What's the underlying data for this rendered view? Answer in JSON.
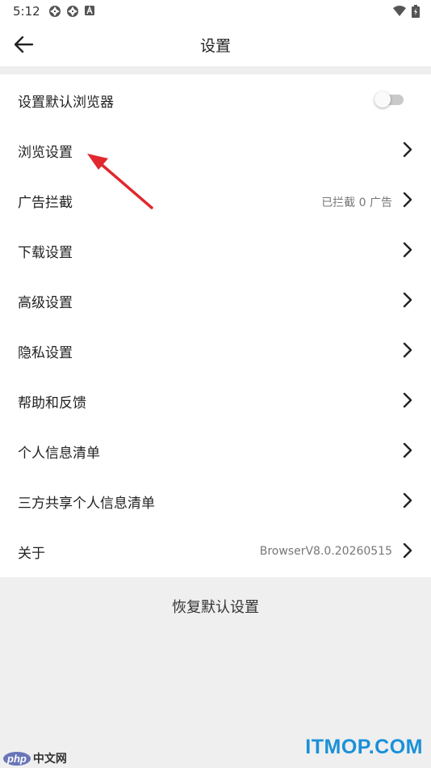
{
  "status_bar": {
    "time": "5:12",
    "left_icons": [
      "shutter-icon",
      "shutter-icon",
      "a-badge-icon"
    ],
    "right_icons": [
      "wifi-icon",
      "battery-charging-icon"
    ]
  },
  "header": {
    "title": "设置",
    "back_icon": "arrow-left-icon"
  },
  "settings": {
    "items": [
      {
        "key": "default-browser",
        "label": "设置默认浏览器",
        "control": "toggle",
        "toggle_on": false
      },
      {
        "key": "browse-settings",
        "label": "浏览设置",
        "control": "chevron"
      },
      {
        "key": "ad-block",
        "label": "广告拦截",
        "value": "已拦截 0 广告",
        "control": "chevron"
      },
      {
        "key": "download-settings",
        "label": "下载设置",
        "control": "chevron"
      },
      {
        "key": "advanced-settings",
        "label": "高级设置",
        "control": "chevron"
      },
      {
        "key": "privacy-settings",
        "label": "隐私设置",
        "control": "chevron"
      },
      {
        "key": "help-feedback",
        "label": "帮助和反馈",
        "control": "chevron"
      },
      {
        "key": "personal-info-list",
        "label": "个人信息清单",
        "control": "chevron"
      },
      {
        "key": "third-party-info-list",
        "label": "三方共享个人信息清单",
        "control": "chevron"
      },
      {
        "key": "about",
        "label": "关于",
        "value": "BrowserV8.0.20260515",
        "control": "chevron"
      }
    ]
  },
  "footer": {
    "restore_label": "恢复默认设置"
  },
  "watermarks": {
    "left_logo": "php",
    "left_text": "中文网",
    "right_text": "ITMOP.COM"
  },
  "colors": {
    "background": "#efefef",
    "surface": "#ffffff",
    "text_primary": "#222222",
    "text_secondary": "#777777",
    "annotation_arrow": "#e0282e",
    "watermark_blue": "#1a90d8"
  }
}
